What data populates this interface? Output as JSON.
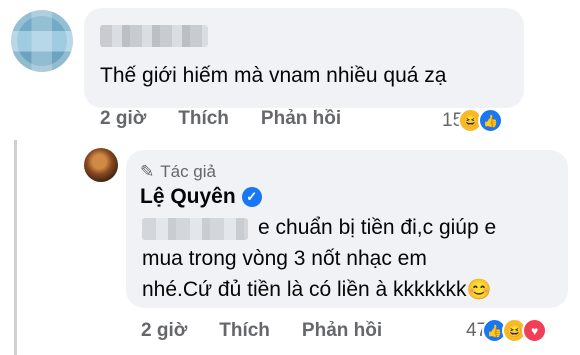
{
  "comment1": {
    "text": "Thế giới hiếm mà vnam nhiều quá zạ",
    "time": "2 giờ",
    "like_label": "Thích",
    "reply_label": "Phản hồi",
    "reaction_count": "15",
    "reactions": [
      "haha-icon",
      "like-icon"
    ]
  },
  "reply": {
    "badge": "Tác giả",
    "author": "Lệ Quyên",
    "line1": "e chuẩn bị tiền đi,c giúp e",
    "line2": "mua trong vòng 3 nốt nhạc em",
    "line3": "nhé.Cứ đủ tiền là có liền à kkkkkkk",
    "emoji": "😊",
    "time": "2 giờ",
    "like_label": "Thích",
    "reply_label": "Phản hồi",
    "reaction_count": "47",
    "reactions": [
      "like-icon",
      "haha-icon",
      "love-icon"
    ]
  },
  "colors": {
    "bubble": "#f0f2f5",
    "secondary_text": "#65676b",
    "like_blue": "#1877f2"
  }
}
